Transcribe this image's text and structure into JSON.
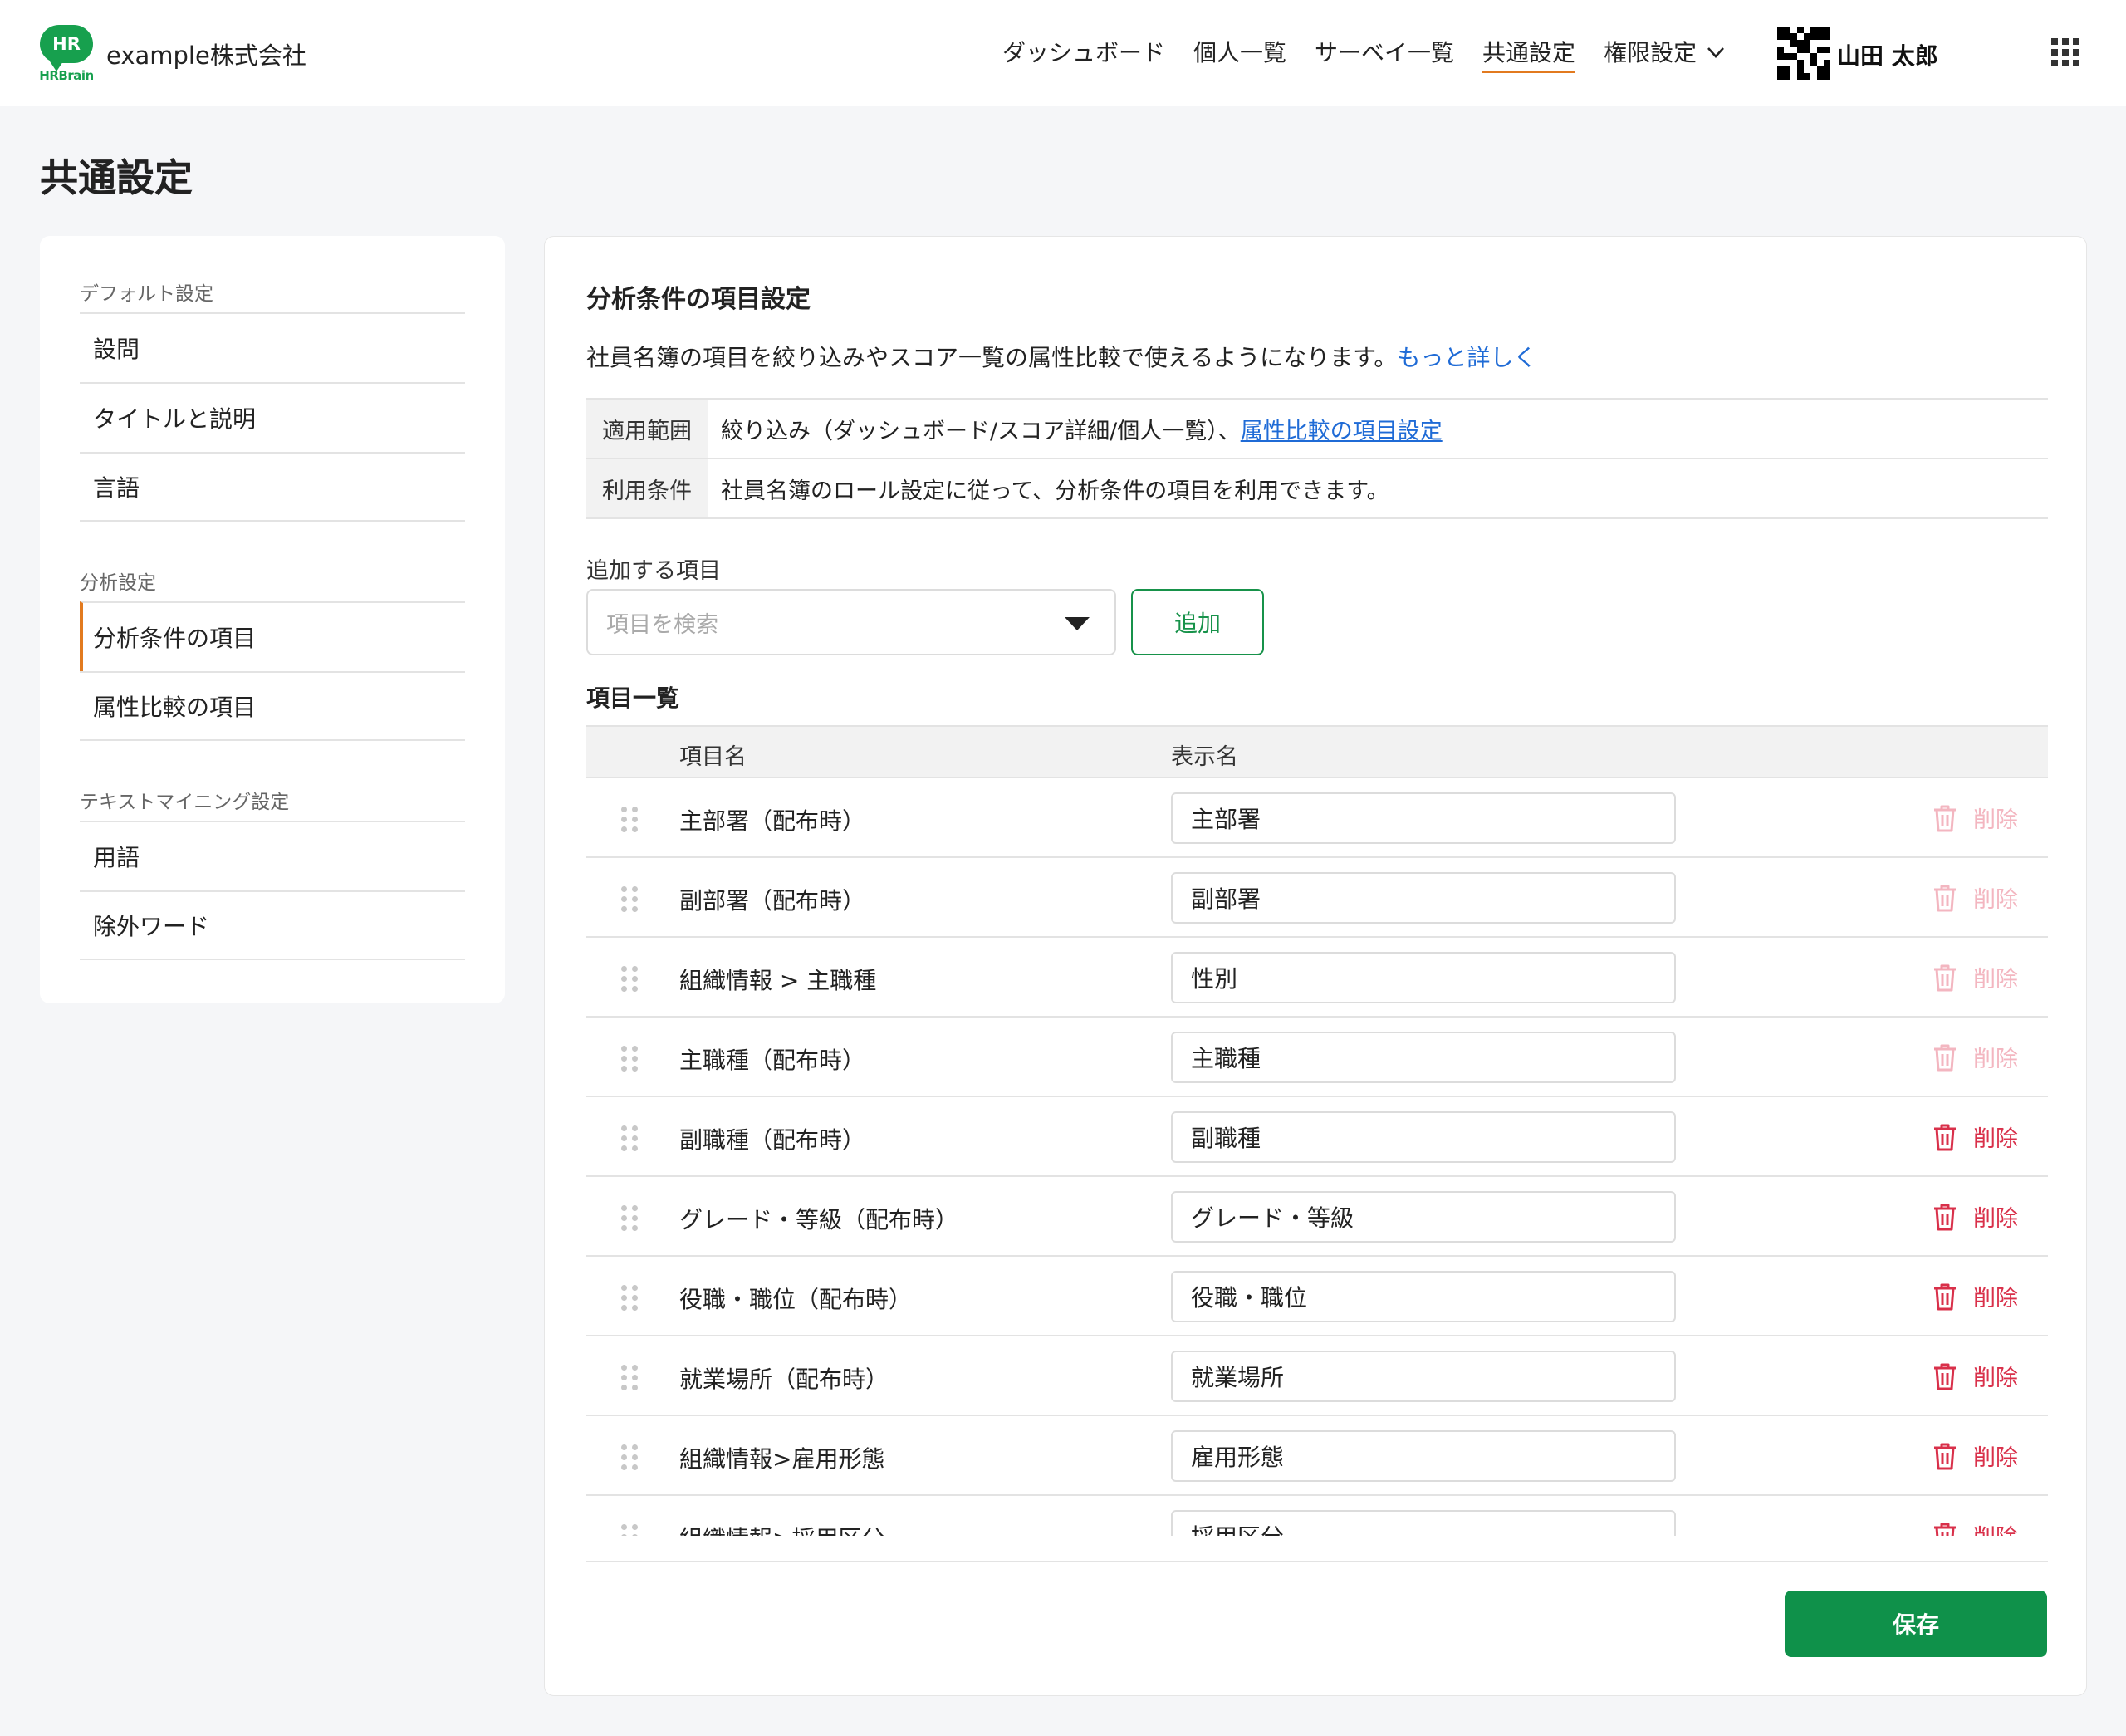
{
  "header": {
    "logo_text": "HR",
    "logo_word": "HRBrain",
    "company": "example株式会社",
    "nav": [
      {
        "label": "ダッシュボード",
        "active": false
      },
      {
        "label": "個人一覧",
        "active": false
      },
      {
        "label": "サーベイ一覧",
        "active": false
      },
      {
        "label": "共通設定",
        "active": true
      },
      {
        "label": "権限設定",
        "active": false
      }
    ],
    "user_name": "山田 太郎"
  },
  "page": {
    "title": "共通設定"
  },
  "sidebar": {
    "sections": [
      {
        "label": "デフォルト設定",
        "items": [
          "設問",
          "タイトルと説明",
          "言語"
        ]
      },
      {
        "label": "分析設定",
        "items": [
          "分析条件の項目",
          "属性比較の項目"
        ]
      },
      {
        "label": "テキストマイニング設定",
        "items": [
          "用語",
          "除外ワード"
        ]
      }
    ],
    "active_item": "分析条件の項目"
  },
  "main": {
    "title": "分析条件の項目設定",
    "description": "社員名簿の項目を絞り込みやスコア一覧の属性比較で使えるようになります。",
    "more_link": "もっと詳しく",
    "info": [
      {
        "label": "適用範囲",
        "value": "絞り込み（ダッシュボード/スコア詳細/個人一覧）、",
        "link": "属性比較の項目設定"
      },
      {
        "label": "利用条件",
        "value": "社員名簿のロール設定に従って、分析条件の項目を利用できます。",
        "link": ""
      }
    ],
    "add_label": "追加する項目",
    "search_placeholder": "項目を検索",
    "add_button": "追加",
    "list_title": "項目一覧",
    "columns": {
      "name": "項目名",
      "display": "表示名"
    },
    "delete_label": "削除",
    "rows": [
      {
        "name": "主部署（配布時）",
        "display": "主部署",
        "deletable": false
      },
      {
        "name": "副部署（配布時）",
        "display": "副部署",
        "deletable": false
      },
      {
        "name": "組織情報 > 主職種",
        "display": "性別",
        "deletable": false
      },
      {
        "name": "主職種（配布時）",
        "display": "主職種",
        "deletable": false
      },
      {
        "name": "副職種（配布時）",
        "display": "副職種",
        "deletable": true
      },
      {
        "name": "グレード・等級（配布時）",
        "display": "グレード・等級",
        "deletable": true
      },
      {
        "name": "役職・職位（配布時）",
        "display": "役職・職位",
        "deletable": true
      },
      {
        "name": "就業場所（配布時）",
        "display": "就業場所",
        "deletable": true
      },
      {
        "name": "組織情報>雇用形態",
        "display": "雇用形態",
        "deletable": true
      },
      {
        "name": "組織情報>採用区分",
        "display": "採用区分",
        "deletable": true
      }
    ],
    "save_button": "保存"
  },
  "colors": {
    "brand_green": "#17a04e",
    "save_green": "#0f914a",
    "active_orange": "#e27a1f",
    "delete_red": "#d9304a",
    "link_blue": "#1f6bd6"
  }
}
